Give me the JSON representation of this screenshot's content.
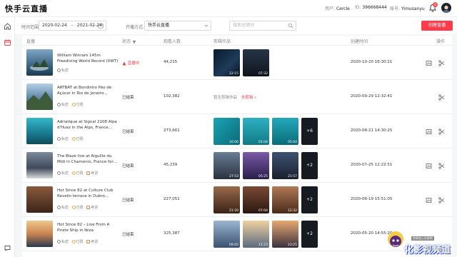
{
  "app": {
    "title": "快手云直播"
  },
  "header": {
    "user_label": "用户:",
    "user_value": "Cercle",
    "id_label": "ID:",
    "id_value": "396668444",
    "account_label": "账号:",
    "account_value": "Yimusanyu",
    "notif_count": "9"
  },
  "filters": {
    "time_label": "时间范围:",
    "date_start": "2020-02-24",
    "date_sep": "-",
    "date_end": "2021-02-24",
    "method_label": "开播方式:",
    "method_value": "快手云直播",
    "search_placeholder": "搜索关键词",
    "create_button": "创建直播"
  },
  "table": {
    "columns": {
      "live": "直播",
      "status": "状态",
      "viewers": "观看人数",
      "clips": "剪辑作品",
      "created": "创建时间",
      "ops": "操作"
    },
    "rows": [
      {
        "title": "William Winram 145m Freediving World Record (VWT)",
        "tags": [
          "私密"
        ],
        "status": "直播中",
        "viewers": "44,215",
        "clips": [
          "22:15",
          "07:32"
        ],
        "more": "",
        "created": "2020-10-20 16:30:21"
      },
      {
        "title": "ARTBAT at Bondinho Pão de Açúcar in Rio de Janeiro...",
        "tags": [
          "私密",
          "付费"
        ],
        "status": "已结束",
        "viewers": "102,382",
        "clips": [],
        "no_clip": "暂无剪辑作品",
        "no_clip_action": "去剪辑",
        "more": "",
        "created": "2020-09-29 12:32:41"
      },
      {
        "title": "Adriatique at Signal 2108 Alpe d'Huez in the Alps, France...",
        "tags": [
          "私密",
          "付费"
        ],
        "status": "已结束",
        "viewers": "273,661",
        "clips": [
          "16:06",
          "01:04",
          "05:04"
        ],
        "more": "+6",
        "created": "2020-08-21 14:30:25"
      },
      {
        "title": "The Blaze live at Aiguille du Midi in Chamonix, France for...",
        "tags": [
          "私密",
          "付费",
          "卖货"
        ],
        "status": "已结束",
        "viewers": "45,239",
        "clips": [
          "27:53",
          "05:25",
          "21:57"
        ],
        "more": "+2",
        "created": "2020-07-25 12:22:51"
      },
      {
        "title": "Hot Since 82 at Culture Club Revelin terrace in Dubro...",
        "tags": [
          "私密",
          "付费",
          "卖货"
        ],
        "status": "已结束",
        "viewers": "227,051",
        "clips": [
          "21:20",
          "07:04",
          "12:32"
        ],
        "more": "+2",
        "created": "2020-06-19 15:51:05"
      },
      {
        "title": "Hot Since 82 – Live From A Pirate Ship in Ibiza",
        "tags": [
          "私密",
          "付费",
          "卖货"
        ],
        "status": "已结束",
        "viewers": "325,387",
        "clips": [
          "09:05",
          "11:23",
          "23:25"
        ],
        "more": "+2",
        "created": "2020-05-20 14:55:20"
      }
    ]
  },
  "watermark": {
    "text": "化影视频道",
    "sub": "快来加入社群吧"
  },
  "colors": {
    "accent": "#fe3b4a",
    "live": "#fe3b4a",
    "more_tile": "#161b22"
  }
}
